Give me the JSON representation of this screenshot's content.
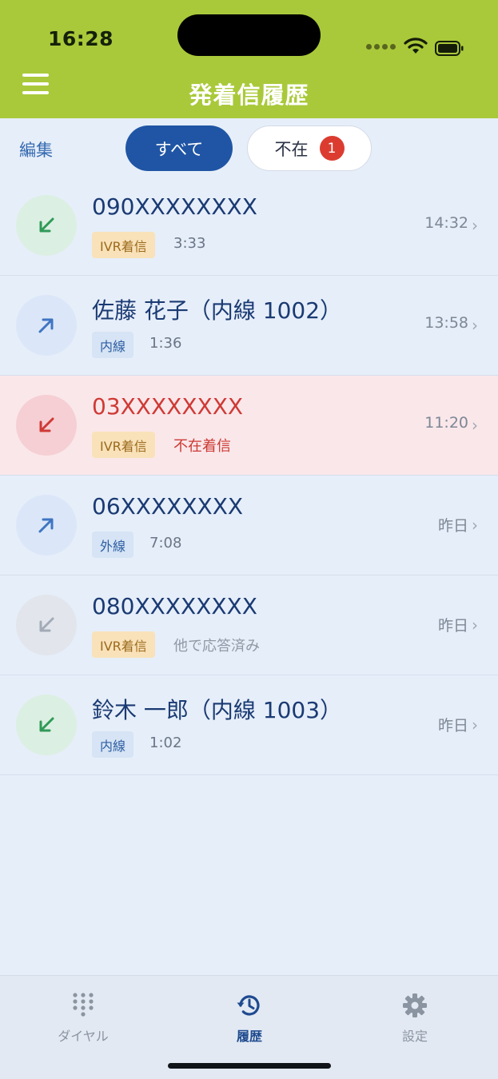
{
  "status_bar": {
    "time": "16:28"
  },
  "header": {
    "title": "発着信履歴",
    "menu_icon": "hamburger-icon",
    "background": "#a9c93a"
  },
  "filter": {
    "edit_label": "編集",
    "segments": [
      {
        "label": "すべて",
        "selected": true
      },
      {
        "label": "不在",
        "badge": "1",
        "selected": false
      }
    ]
  },
  "calls": [
    {
      "name": "090XXXXXXXX",
      "tag": "IVR着信",
      "tag_type": "ivr",
      "detail": "3:33",
      "time": "14:32",
      "direction": "incoming",
      "missed": false
    },
    {
      "name": "佐藤 花子（内線 1002）",
      "tag": "内線",
      "tag_type": "line",
      "detail": "1:36",
      "time": "13:58",
      "direction": "outgoing",
      "missed": false
    },
    {
      "name": "03XXXXXXXX",
      "tag": "IVR着信",
      "tag_type": "ivr",
      "detail": "不在着信",
      "time": "11:20",
      "direction": "incoming",
      "missed": true
    },
    {
      "name": "06XXXXXXXX",
      "tag": "外線",
      "tag_type": "line",
      "detail": "7:08",
      "time": "昨日",
      "direction": "outgoing",
      "missed": false
    },
    {
      "name": "080XXXXXXXX",
      "tag": "IVR着信",
      "tag_type": "ivr",
      "detail": "他で応答済み",
      "time": "昨日",
      "direction": "answered-elsewhere",
      "missed": false
    },
    {
      "name": "鈴木 一郎（内線 1003）",
      "tag": "内線",
      "tag_type": "line",
      "detail": "1:02",
      "time": "昨日",
      "direction": "incoming",
      "missed": false
    }
  ],
  "tabs": [
    {
      "label": "ダイヤル",
      "icon": "dialpad-icon",
      "active": false
    },
    {
      "label": "履歴",
      "icon": "history-icon",
      "active": true
    },
    {
      "label": "設定",
      "icon": "gear-icon",
      "active": false
    }
  ],
  "colors": {
    "accent": "#1f55a4",
    "missed": "#cf3a35",
    "incoming": "#2f9a57",
    "outgoing": "#3f75c2",
    "answered_elsewhere": "#a3abb7"
  }
}
